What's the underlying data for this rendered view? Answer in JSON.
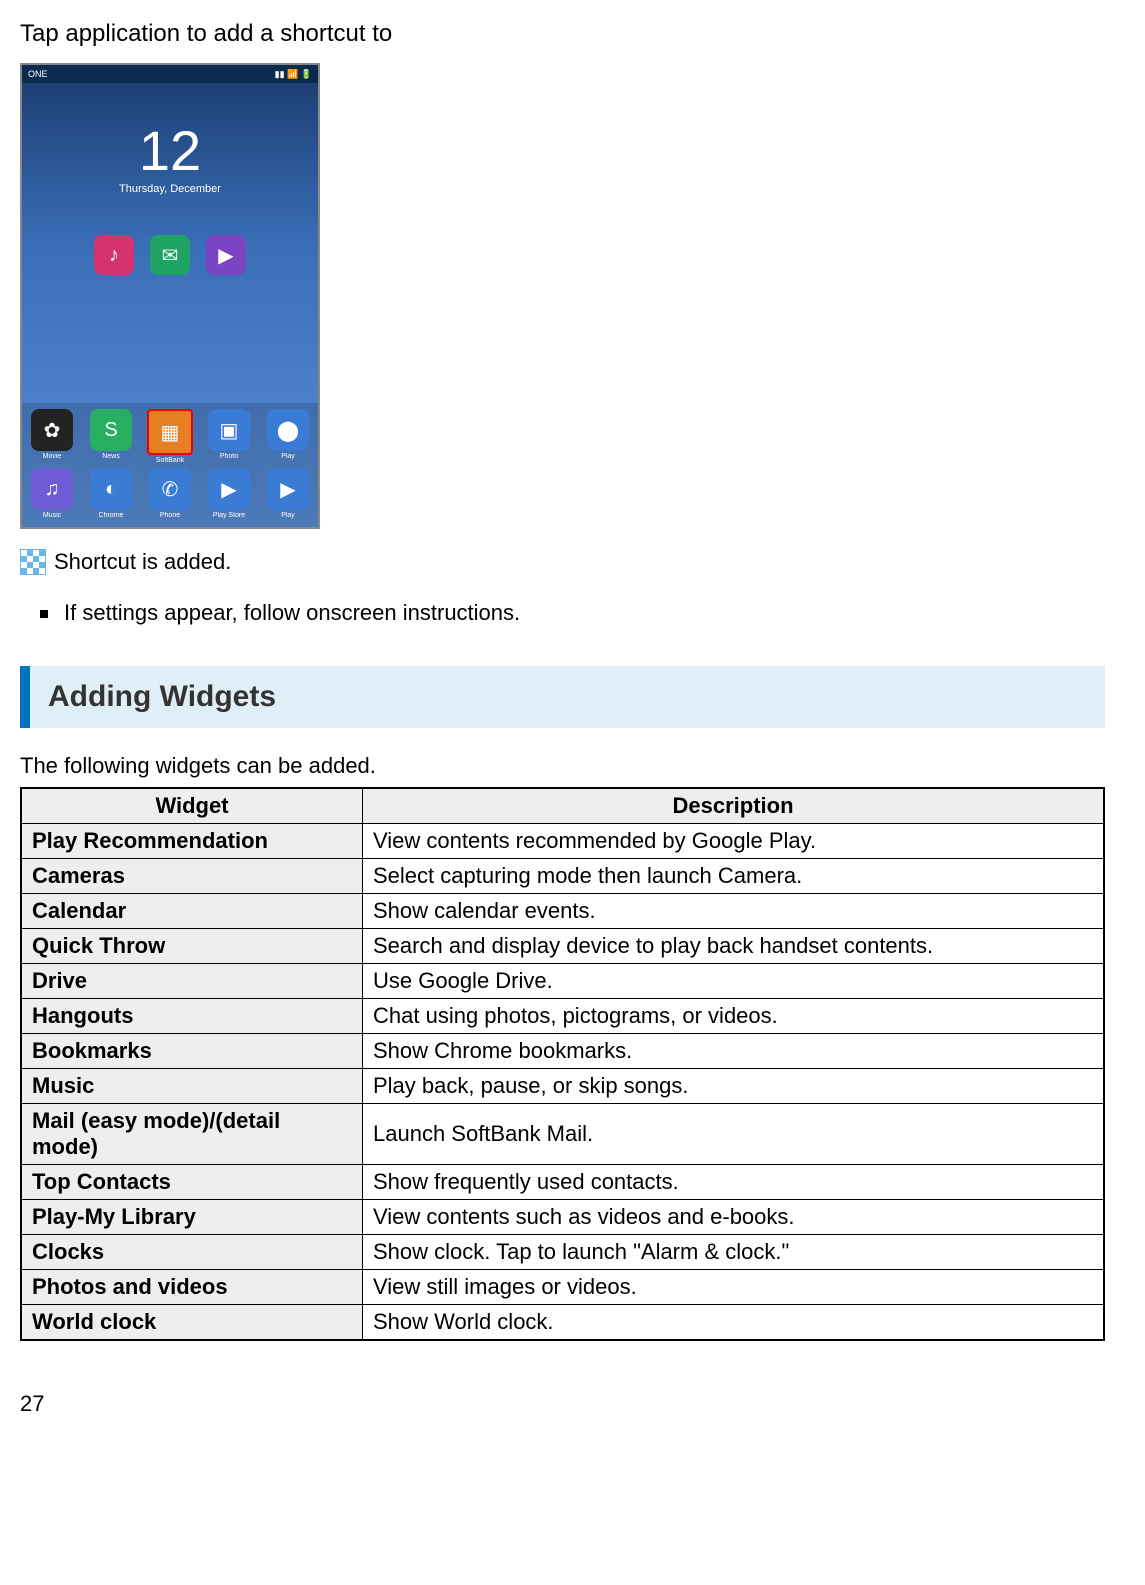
{
  "instruction": "Tap application to add a shortcut to",
  "phone": {
    "statusbar_left": "ONE",
    "statusbar_right": "▮▮ 📶 🔋",
    "clock_time": "12",
    "clock_date": "Thursday, December",
    "mid_icons": [
      {
        "bg": "#d6326e",
        "glyph": "♪"
      },
      {
        "bg": "#1da462",
        "glyph": "✉"
      },
      {
        "bg": "#7a44c2",
        "glyph": "▶"
      }
    ],
    "dock_row1": [
      {
        "bg": "#222",
        "glyph": "✿",
        "label": "Movie"
      },
      {
        "bg": "#27ae60",
        "glyph": "S",
        "label": "News"
      },
      {
        "bg": "#e67e22",
        "glyph": "▦",
        "label": "SoftBank",
        "highlight": true
      },
      {
        "bg": "#3a7bd5",
        "glyph": "▣",
        "label": "Photo"
      },
      {
        "bg": "#3a7bd5",
        "glyph": "⬤",
        "label": "Play"
      }
    ],
    "dock_row2": [
      {
        "bg": "#6e5bd6",
        "glyph": "♫",
        "label": "Music"
      },
      {
        "bg": "#3a7bd5",
        "glyph": "◐",
        "label": "Chrome"
      },
      {
        "bg": "#3a7bd5",
        "glyph": "✆",
        "label": "Phone"
      },
      {
        "bg": "#3a7bd5",
        "glyph": "▶",
        "label": "Play Store"
      },
      {
        "bg": "#3a7bd5",
        "glyph": "▶",
        "label": "Play"
      }
    ]
  },
  "result_text": "Shortcut is added.",
  "bullet_items": [
    "If settings appear, follow onscreen instructions."
  ],
  "section_heading": "Adding Widgets",
  "section_intro": "The following widgets can be added.",
  "table": {
    "header_widget": "Widget",
    "header_description": "Description",
    "rows": [
      {
        "widget": "Play Recommendation",
        "description": "View contents recommended by Google Play."
      },
      {
        "widget": "Cameras",
        "description": "Select capturing mode then launch Camera."
      },
      {
        "widget": "Calendar",
        "description": "Show calendar events."
      },
      {
        "widget": "Quick Throw",
        "description": "Search and display device to play back handset contents."
      },
      {
        "widget": "Drive",
        "description": "Use Google Drive."
      },
      {
        "widget": "Hangouts",
        "description": "Chat using photos, pictograms, or videos."
      },
      {
        "widget": "Bookmarks",
        "description": "Show Chrome bookmarks."
      },
      {
        "widget": "Music",
        "description": "Play back, pause, or skip songs."
      },
      {
        "widget": "Mail (easy mode)/(detail mode)",
        "description": "Launch SoftBank Mail."
      },
      {
        "widget": "Top Contacts",
        "description": "Show frequently used contacts."
      },
      {
        "widget": "Play-My Library",
        "description": "View contents such as videos and e-books."
      },
      {
        "widget": "Clocks",
        "description": "Show clock. Tap to launch \"Alarm & clock.\""
      },
      {
        "widget": "Photos and videos",
        "description": "View still images or videos."
      },
      {
        "widget": "World clock",
        "description": "Show World clock."
      }
    ]
  },
  "page_number": "27"
}
